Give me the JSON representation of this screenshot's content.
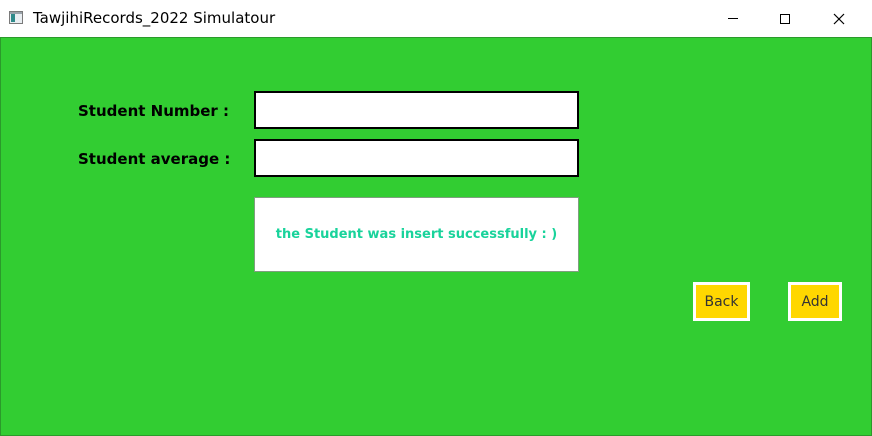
{
  "window": {
    "title": "TawjihiRecords_2022 Simulatour",
    "controls": {
      "minimize": "minimize-icon",
      "maximize": "maximize-icon",
      "close": "✕"
    }
  },
  "form": {
    "student_number_label": "Student Number :",
    "student_number_value": "",
    "student_average_label": "Student average :",
    "student_average_value": "",
    "message": "the Student was insert successfully : )",
    "back_label": "Back",
    "add_label": "Add"
  },
  "colors": {
    "background": "#32cd32",
    "button": "#ffd700",
    "message_text": "#19d39b"
  }
}
